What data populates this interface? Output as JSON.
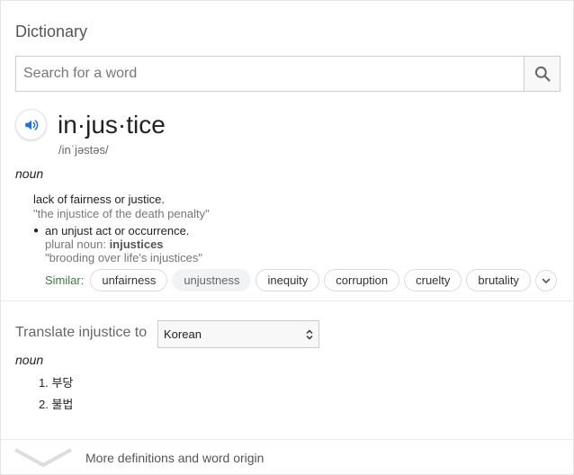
{
  "header": {
    "title": "Dictionary"
  },
  "search": {
    "placeholder": "Search for a word",
    "value": ""
  },
  "entry": {
    "word": "in·jus·tice",
    "phonetic": "/inˈjəstəs/",
    "part_of_speech": "noun",
    "definitions": [
      {
        "text": "lack of fairness or justice.",
        "example": "\"the injustice of the death penalty\""
      },
      {
        "text": "an unjust act or occurrence.",
        "plural_label": "plural noun: ",
        "plural_value": "injustices",
        "example": "\"brooding over life's injustices\""
      }
    ],
    "similar_label": "Similar:",
    "similar": [
      "unfairness",
      "unjustness",
      "inequity",
      "corruption",
      "cruelty",
      "brutality"
    ]
  },
  "translate": {
    "label": "Translate injustice to",
    "language": "Korean",
    "part_of_speech": "noun",
    "items": [
      "1. 부당",
      "2. 불법"
    ]
  },
  "footer": {
    "label": "More definitions and word origin"
  },
  "colors": {
    "similar_label": "#3b7c3b",
    "audio_icon": "#1a73e8"
  }
}
